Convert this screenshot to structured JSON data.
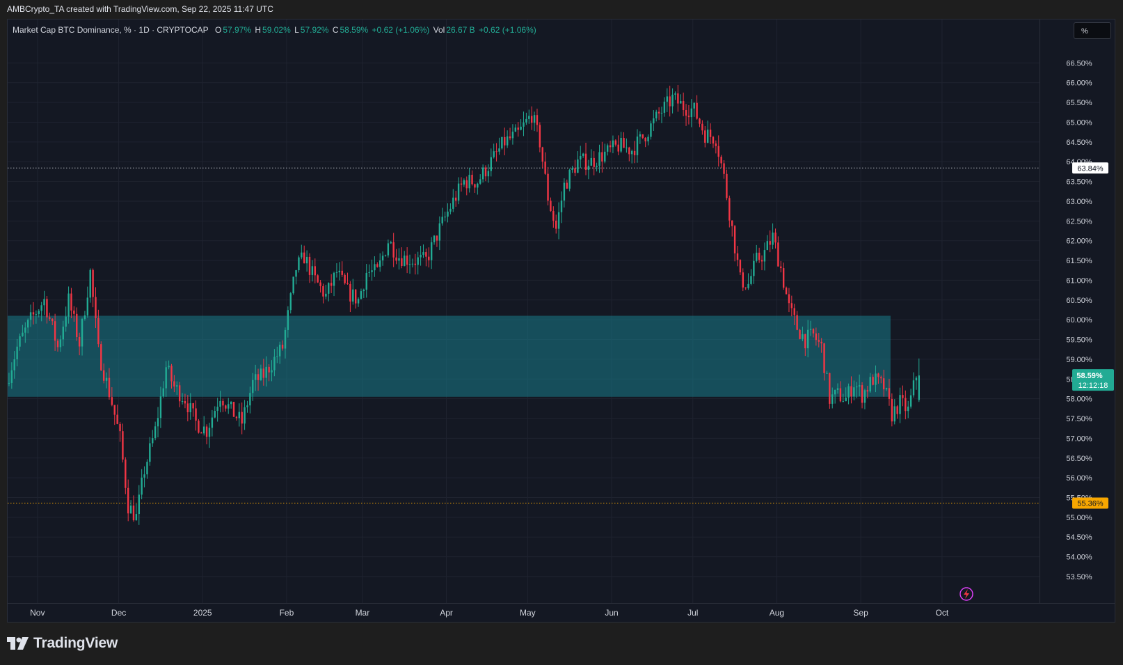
{
  "banner": "AMBCrypto_TA created with TradingView.com, Sep 22, 2025 11:47 UTC",
  "legend": {
    "symbol": "Market Cap BTC Dominance, % · 1D · CRYPTOCAP",
    "o_label": "O",
    "o_value": "57.97%",
    "h_label": "H",
    "h_value": "59.02%",
    "l_label": "L",
    "l_value": "57.92%",
    "c_label": "C",
    "c_value": "58.59%",
    "change": "+0.62 (+1.06%)",
    "vol_label": "Vol",
    "vol_value": "26.67 B",
    "vol_change": "+0.62 (+1.06%)"
  },
  "scale_button": "%",
  "brand": "TradingView",
  "colors": {
    "up": "#22ab94",
    "down": "#f23645",
    "zone": "#0f4a55",
    "zone_fill": "#177b8a",
    "resistance_line": "#b2b5be",
    "support_line": "#f7a600",
    "current_price_bg": "#22ab94"
  },
  "chart_data": {
    "type": "candlestick",
    "title": "Market Cap BTC Dominance, % · 1D · CRYPTOCAP",
    "y_unit": "%",
    "ylim": [
      53.2,
      67.0
    ],
    "y_ticks": [
      "66.50%",
      "66.00%",
      "65.50%",
      "65.00%",
      "64.50%",
      "64.00%",
      "63.50%",
      "63.00%",
      "62.50%",
      "62.00%",
      "61.50%",
      "61.00%",
      "60.50%",
      "60.00%",
      "59.50%",
      "59.00%",
      "58.50%",
      "58.00%",
      "57.50%",
      "57.00%",
      "56.50%",
      "56.00%",
      "55.50%",
      "55.00%",
      "54.50%",
      "54.00%",
      "53.50%"
    ],
    "y_tick_values": [
      66.5,
      66.0,
      65.5,
      65.0,
      64.5,
      64.0,
      63.5,
      63.0,
      62.5,
      62.0,
      61.5,
      61.0,
      60.5,
      60.0,
      59.5,
      59.0,
      58.5,
      58.0,
      57.5,
      57.0,
      56.5,
      56.0,
      55.5,
      55.0,
      54.5,
      54.0,
      53.5
    ],
    "x_labels": [
      "Nov",
      "Dec",
      "2025",
      "Feb",
      "Mar",
      "Apr",
      "May",
      "Jun",
      "Jul",
      "Aug",
      "Sep",
      "Oct"
    ],
    "x_label_dates": [
      "2024-11-01",
      "2024-12-01",
      "2025-01-01",
      "2025-02-01",
      "2025-03-01",
      "2025-04-01",
      "2025-05-01",
      "2025-06-01",
      "2025-07-01",
      "2025-08-01",
      "2025-09-01",
      "2025-10-01"
    ],
    "x_range": [
      "2024-10-21",
      "2025-11-06"
    ],
    "grid": true,
    "zone": {
      "from_date": "2024-10-21",
      "to_date": "2025-09-12",
      "low": 58.05,
      "high": 60.1
    },
    "horizontal_lines": [
      {
        "value": 63.84,
        "label": "63.84%",
        "style": "dotted",
        "color": "#b2b5be"
      },
      {
        "value": 55.36,
        "label": "55.36%",
        "style": "dotted",
        "color": "#f7a600"
      }
    ],
    "current_price": {
      "label": "58.59%",
      "countdown": "12:12:18",
      "value": 58.59
    },
    "anchors": [
      [
        "2024-10-21",
        58.4
      ],
      [
        "2024-10-25",
        59.3
      ],
      [
        "2024-10-30",
        60.0
      ],
      [
        "2024-11-04",
        60.5
      ],
      [
        "2024-11-09",
        59.3
      ],
      [
        "2024-11-13",
        60.5
      ],
      [
        "2024-11-17",
        59.4
      ],
      [
        "2024-11-21",
        61.2
      ],
      [
        "2024-11-24",
        59.2
      ],
      [
        "2024-11-29",
        57.9
      ],
      [
        "2024-12-02",
        57.0
      ],
      [
        "2024-12-05",
        55.3
      ],
      [
        "2024-12-08",
        55.0
      ],
      [
        "2024-12-11",
        56.2
      ],
      [
        "2024-12-15",
        57.2
      ],
      [
        "2024-12-19",
        58.8
      ],
      [
        "2024-12-22",
        58.3
      ],
      [
        "2024-12-26",
        58.0
      ],
      [
        "2024-12-30",
        57.4
      ],
      [
        "2025-01-03",
        57.2
      ],
      [
        "2025-01-08",
        58.1
      ],
      [
        "2025-01-12",
        57.7
      ],
      [
        "2025-01-16",
        57.4
      ],
      [
        "2025-01-20",
        58.4
      ],
      [
        "2025-01-24",
        58.6
      ],
      [
        "2025-01-28",
        59.0
      ],
      [
        "2025-01-31",
        59.3
      ],
      [
        "2025-02-03",
        60.5
      ],
      [
        "2025-02-05",
        61.3
      ],
      [
        "2025-02-08",
        61.6
      ],
      [
        "2025-02-12",
        61.0
      ],
      [
        "2025-02-16",
        60.6
      ],
      [
        "2025-02-20",
        61.2
      ],
      [
        "2025-02-24",
        60.7
      ],
      [
        "2025-02-28",
        60.5
      ],
      [
        "2025-03-03",
        61.2
      ],
      [
        "2025-03-07",
        61.2
      ],
      [
        "2025-03-11",
        62.0
      ],
      [
        "2025-03-15",
        61.6
      ],
      [
        "2025-03-20",
        61.5
      ],
      [
        "2025-03-25",
        61.5
      ],
      [
        "2025-03-30",
        62.3
      ],
      [
        "2025-04-04",
        63.0
      ],
      [
        "2025-04-08",
        63.5
      ],
      [
        "2025-04-13",
        63.5
      ],
      [
        "2025-04-18",
        64.0
      ],
      [
        "2025-04-23",
        64.5
      ],
      [
        "2025-04-28",
        64.7
      ],
      [
        "2025-05-03",
        65.2
      ],
      [
        "2025-05-06",
        64.5
      ],
      [
        "2025-05-09",
        63.1
      ],
      [
        "2025-05-12",
        62.3
      ],
      [
        "2025-05-15",
        63.4
      ],
      [
        "2025-05-20",
        64.0
      ],
      [
        "2025-05-25",
        64.0
      ],
      [
        "2025-05-30",
        64.2
      ],
      [
        "2025-06-04",
        64.4
      ],
      [
        "2025-06-09",
        64.3
      ],
      [
        "2025-06-14",
        64.7
      ],
      [
        "2025-06-19",
        65.2
      ],
      [
        "2025-06-24",
        65.6
      ],
      [
        "2025-06-28",
        65.4
      ],
      [
        "2025-07-02",
        65.3
      ],
      [
        "2025-07-06",
        64.7
      ],
      [
        "2025-07-10",
        64.6
      ],
      [
        "2025-07-13",
        63.6
      ],
      [
        "2025-07-16",
        62.3
      ],
      [
        "2025-07-19",
        61.0
      ],
      [
        "2025-07-22",
        60.9
      ],
      [
        "2025-07-25",
        61.5
      ],
      [
        "2025-07-28",
        61.7
      ],
      [
        "2025-07-31",
        62.1
      ],
      [
        "2025-08-03",
        61.3
      ],
      [
        "2025-08-06",
        60.3
      ],
      [
        "2025-08-09",
        59.8
      ],
      [
        "2025-08-12",
        59.5
      ],
      [
        "2025-08-15",
        59.6
      ],
      [
        "2025-08-18",
        59.3
      ],
      [
        "2025-08-21",
        58.0
      ],
      [
        "2025-08-24",
        58.1
      ],
      [
        "2025-08-27",
        58.0
      ],
      [
        "2025-08-30",
        58.4
      ],
      [
        "2025-09-02",
        58.1
      ],
      [
        "2025-09-06",
        58.5
      ],
      [
        "2025-09-10",
        58.3
      ],
      [
        "2025-09-13",
        57.6
      ],
      [
        "2025-09-16",
        57.9
      ],
      [
        "2025-09-19",
        57.7
      ],
      [
        "2025-09-22",
        58.59
      ]
    ],
    "last_candle": {
      "date": "2025-09-22",
      "open": 57.97,
      "high": 59.02,
      "low": 57.92,
      "close": 58.59
    }
  }
}
